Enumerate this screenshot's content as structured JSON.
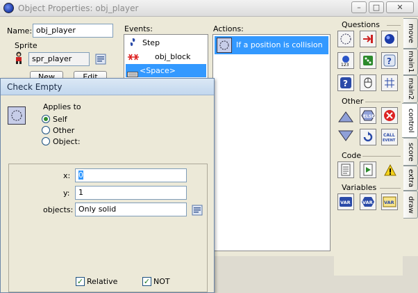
{
  "window": {
    "title": "Object Properties: obj_player",
    "minimize": "–",
    "maximize": "□",
    "close": "✕"
  },
  "object": {
    "name_label": "Name:",
    "name_value": "obj_player",
    "sprite_label": "Sprite",
    "sprite_value": "spr_player",
    "new_label": "New",
    "edit_label": "Edit"
  },
  "events": {
    "label": "Events:",
    "items": [
      {
        "name": "Step",
        "icon": "step-icon"
      },
      {
        "name": "obj_block",
        "icon": "collision-icon"
      },
      {
        "name": "<Space>",
        "icon": "keyboard-icon"
      }
    ],
    "selected_index": 2
  },
  "actions": {
    "label": "Actions:",
    "items": [
      {
        "name": "If a position is collision free",
        "icon": "check-empty-icon"
      }
    ]
  },
  "palette": {
    "groups": [
      {
        "title": "Questions"
      },
      {
        "title": "Other"
      },
      {
        "title": "Code"
      },
      {
        "title": "Variables"
      }
    ],
    "tabs": [
      "move",
      "main1",
      "main2",
      "control",
      "score",
      "extra",
      "draw"
    ],
    "active_tab": "control",
    "labels": {
      "else": "ELSE",
      "call": "CALL",
      "event": "EVENT",
      "var": "VAR",
      "num": "123"
    }
  },
  "dialog": {
    "title": "Check Empty",
    "applies_to_label": "Applies to",
    "radio_self": "Self",
    "radio_other": "Other",
    "radio_object": "Object:",
    "x_label": "x:",
    "x_value": "0",
    "y_label": "y:",
    "y_value": "1",
    "objects_label": "objects:",
    "objects_value": "Only solid",
    "relative_label": "Relative",
    "not_label": "NOT",
    "relative_checked": true,
    "not_checked": true
  },
  "colors": {
    "selection": "#3399ff",
    "titlebar": "#c2d7ee"
  }
}
